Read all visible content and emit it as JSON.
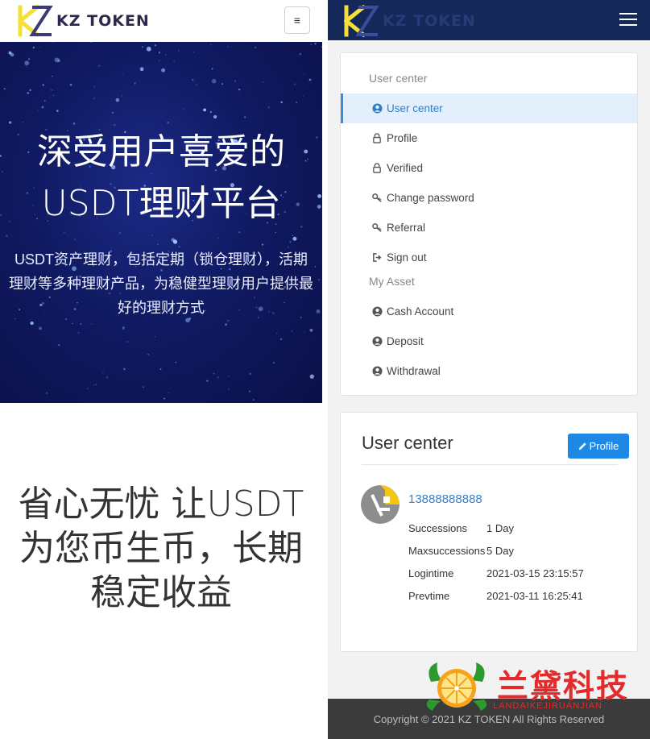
{
  "left": {
    "brand": "KZ TOKEN",
    "toggler_icon": "≡",
    "hero": {
      "title_line1": "深受用户喜爱的",
      "title_line2": "USDT理财平台",
      "description": "USDT资产理财，包括定期（锁仓理财），活期理财等多种理财产品，为稳健型理财用户提供最好的理财方式"
    },
    "slogan": "省心无忧 让USDT为您币生币，长期稳定收益"
  },
  "right": {
    "brand": "KZ TOKEN",
    "menu": {
      "section_user": "User center",
      "user_items": [
        {
          "label": "User center",
          "icon": "user-circle-icon",
          "active": true
        },
        {
          "label": "Profile",
          "icon": "lock-icon",
          "active": false
        },
        {
          "label": "Verified",
          "icon": "lock-icon",
          "active": false
        },
        {
          "label": "Change password",
          "icon": "key-icon",
          "active": false
        },
        {
          "label": "Referral",
          "icon": "key-icon",
          "active": false
        },
        {
          "label": "Sign out",
          "icon": "sign-out-icon",
          "active": false
        }
      ],
      "section_asset": "My Asset",
      "asset_items": [
        {
          "label": "Cash Account",
          "icon": "user-circle-icon"
        },
        {
          "label": "Deposit",
          "icon": "user-circle-icon"
        },
        {
          "label": "Withdrawal",
          "icon": "user-circle-icon"
        }
      ]
    },
    "user_center": {
      "title": "User center",
      "profile_button": "Profile",
      "phone": "13888888888",
      "rows": [
        {
          "key": "Successions",
          "value": "1 Day"
        },
        {
          "key": "Maxsuccessions",
          "value": "5 Day"
        },
        {
          "key": "Logintime",
          "value": "2021-03-15 23:15:57"
        },
        {
          "key": "Prevtime",
          "value": "2021-03-11 16:25:41"
        }
      ]
    },
    "footer": "Copyright © 2021 KZ TOKEN All Rights Reserved",
    "watermark": {
      "text": "兰黛科技",
      "sub": "LANDAIKEJIRUANJIAN"
    }
  },
  "colors": {
    "hero_bg": "#101a62",
    "nav_dark": "#14285a",
    "accent_blue": "#1e88e5",
    "active_menu_bg": "#e3f0fb",
    "logo_yellow": "#f5e03a",
    "watermark_red": "#e32b2b"
  }
}
